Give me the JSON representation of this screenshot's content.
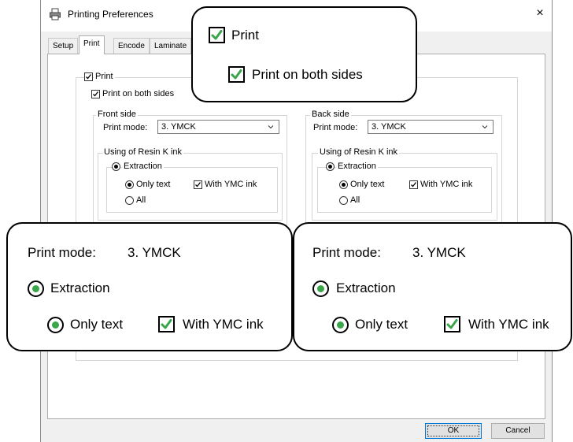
{
  "window": {
    "title": "Printing Preferences",
    "close_glyph": "×"
  },
  "tabs": [
    "Setup",
    "Print",
    "Encode",
    "Laminate"
  ],
  "print_tab": {
    "print_label": "Print",
    "print_both_sides_label": "Print on both sides",
    "front": {
      "group_label": "Front side",
      "print_mode_label": "Print mode:",
      "print_mode_value": "3. YMCK",
      "resin_group_label": "Using of Resin K ink",
      "extraction_label": "Extraction",
      "only_text_label": "Only text",
      "with_ymc_label": "With YMC ink",
      "all_label": "All"
    },
    "back": {
      "group_label": "Back side",
      "print_mode_label": "Print mode:",
      "print_mode_value": "3. YMCK",
      "resin_group_label": "Using of Resin K ink",
      "extraction_label": "Extraction",
      "only_text_label": "Only text",
      "with_ymc_label": "With YMC ink",
      "all_label": "All"
    }
  },
  "callouts": {
    "top": {
      "print_label": "Print",
      "print_both_sides_label": "Print on both sides"
    },
    "front": {
      "print_mode_label": "Print mode:",
      "print_mode_value": "3. YMCK",
      "extraction_label": "Extraction",
      "only_text_label": "Only text",
      "with_ymc_label": "With YMC ink"
    },
    "back": {
      "print_mode_label": "Print mode:",
      "print_mode_value": "3. YMCK",
      "extraction_label": "Extraction",
      "only_text_label": "Only text",
      "with_ymc_label": "With YMC ink"
    }
  },
  "buttons": {
    "ok": "OK",
    "cancel": "Cancel"
  },
  "colors": {
    "check_green": "#3aa64a",
    "default_button_border": "#0078d7"
  }
}
